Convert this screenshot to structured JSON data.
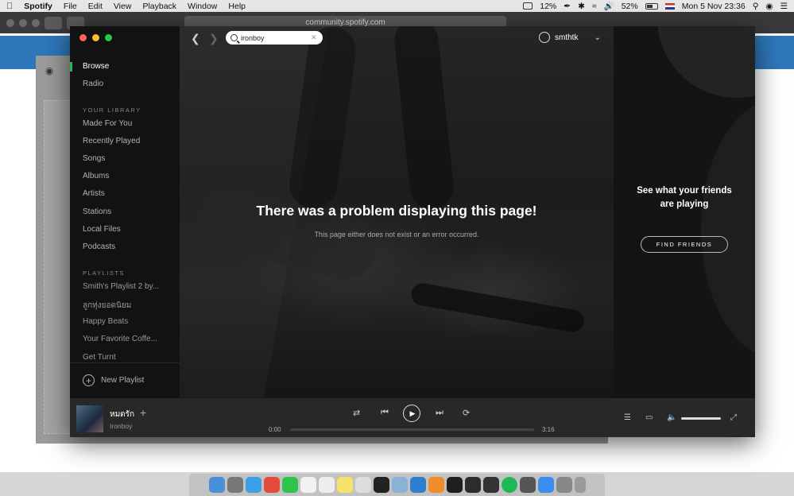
{
  "menubar": {
    "app": "Spotify",
    "menus": [
      "File",
      "Edit",
      "View",
      "Playback",
      "Window",
      "Help"
    ],
    "status": {
      "cpu": "12%",
      "battery": "52%",
      "datetime": "Mon 5 Nov  23:36"
    }
  },
  "browser": {
    "url": "community.spotify.com"
  },
  "sidebar": {
    "nav": [
      "Browse",
      "Radio"
    ],
    "library_heading": "YOUR LIBRARY",
    "library": [
      "Made For You",
      "Recently Played",
      "Songs",
      "Albums",
      "Artists",
      "Stations",
      "Local Files",
      "Podcasts"
    ],
    "playlists_heading": "PLAYLISTS",
    "playlists": [
      "Smith's Playlist 2 by...",
      "ลูกทุ่งยอดนิยม",
      "Happy Beats",
      "Your Favorite Coffe...",
      "Get Turnt"
    ],
    "new_playlist": "New Playlist"
  },
  "topbar": {
    "search_value": "ironboy",
    "username": "smthtk"
  },
  "error": {
    "title": "There was a problem displaying this page!",
    "message": "This page either does not exist or an error occurred."
  },
  "friends": {
    "message_line1": "See what your friends",
    "message_line2": "are playing",
    "button": "FIND FRIENDS"
  },
  "player": {
    "track": "หมดรัก",
    "artist": "Ironboy",
    "elapsed": "0:00",
    "duration": "3:16",
    "progress_fraction": 0,
    "volume_fraction": 0.9
  },
  "colors": {
    "accent": "#1db954",
    "background": "#121212"
  }
}
